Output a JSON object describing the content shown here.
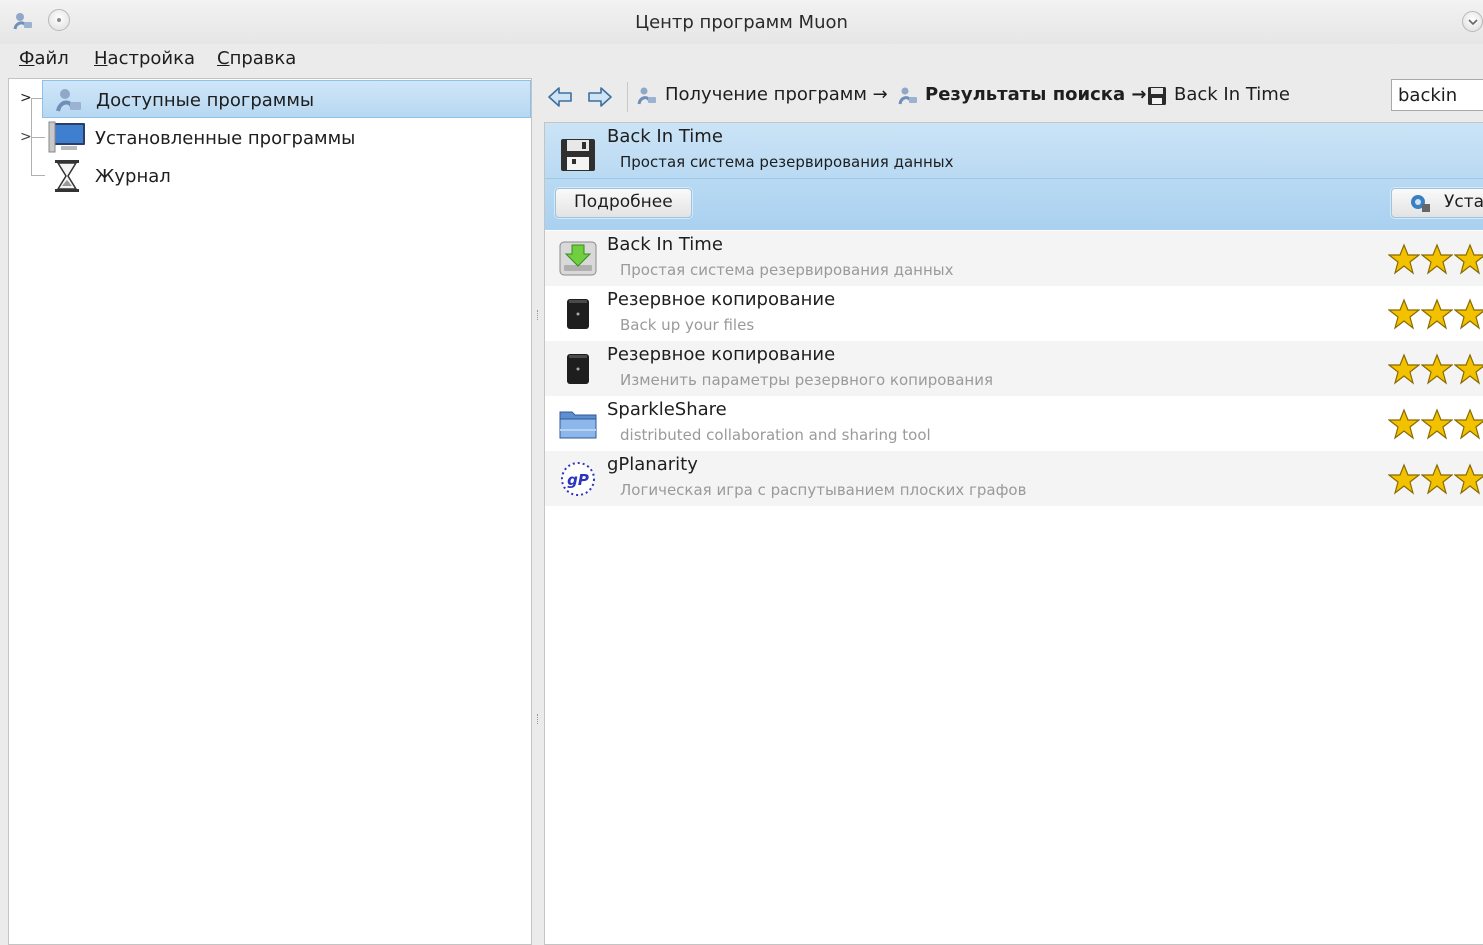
{
  "window": {
    "title": "Центр программ Muon"
  },
  "menu": {
    "items": [
      {
        "underline": "Ф",
        "rest": "айл"
      },
      {
        "underline": "Н",
        "rest": "астройка"
      },
      {
        "underline": "С",
        "rest": "правка"
      }
    ]
  },
  "sidebar": {
    "items": [
      {
        "label": "Доступные программы",
        "icon": "muon-icon",
        "selected": true
      },
      {
        "label": "Установленные программы",
        "icon": "computer-icon"
      },
      {
        "label": "Журнал",
        "icon": "hourglass-icon"
      }
    ]
  },
  "toolbar": {
    "breadcrumbs": [
      {
        "label": "Получение программ →",
        "icon": "muon-icon",
        "bold": false
      },
      {
        "label": "Результаты поиска →",
        "icon": "muon-icon",
        "bold": true
      },
      {
        "label": "Back In Time",
        "icon": "floppy-icon",
        "bold": false
      }
    ]
  },
  "search": {
    "value": "backin"
  },
  "results": {
    "selected": {
      "name": "Back In Time",
      "description": "Простая система резервирования данных",
      "details_button": "Подробнее",
      "install_button": "Уста"
    },
    "items": [
      {
        "name": "Back In Time",
        "description": "Простая система резервирования данных",
        "icon": "download-icon",
        "rating": 3
      },
      {
        "name": "Резервное копирование",
        "description": "Back up your files",
        "icon": "backup-icon",
        "rating": 3
      },
      {
        "name": "Резервное копирование",
        "description": "Изменить параметры резервного копирования",
        "icon": "backup-icon",
        "rating": 3
      },
      {
        "name": "SparkleShare",
        "description": "distributed collaboration and sharing tool",
        "icon": "folder-icon",
        "rating": 3
      },
      {
        "name": "gPlanarity",
        "description": "Логическая игра с распутыванием плоских графов",
        "icon": "gplanarity-icon",
        "rating": 3
      }
    ]
  },
  "colors": {
    "selection": "#b7d8f2",
    "accent": "#3a7fc1",
    "star": "#f2c200"
  }
}
